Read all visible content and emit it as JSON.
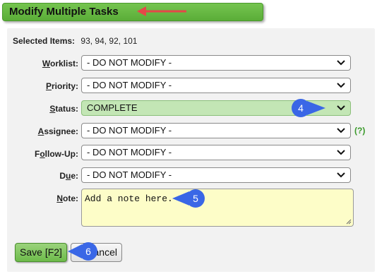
{
  "header": {
    "title": "Modify Multiple Tasks"
  },
  "selected": {
    "label": "Selected Items:",
    "value": "93, 94, 92, 101"
  },
  "fields": {
    "worklist": {
      "pre": "",
      "key": "W",
      "post": "orklist:",
      "value": "- DO NOT MODIFY -"
    },
    "priority": {
      "pre": "",
      "key": "P",
      "post": "riority:",
      "value": "- DO NOT MODIFY -"
    },
    "status": {
      "pre": "",
      "key": "S",
      "post": "tatus:",
      "value": "COMPLETE"
    },
    "assignee": {
      "pre": "",
      "key": "A",
      "post": "ssignee:",
      "value": "- DO NOT MODIFY -"
    },
    "followup": {
      "pre": "F",
      "key": "o",
      "post": "llow-Up:",
      "value": "- DO NOT MODIFY -"
    },
    "due": {
      "pre": "D",
      "key": "u",
      "post": "e:",
      "value": "- DO NOT MODIFY -"
    },
    "note": {
      "pre": "",
      "key": "N",
      "post": "ote:",
      "value": "Add a note here."
    }
  },
  "help_link": "(?)",
  "buttons": {
    "save": "Save [F2]",
    "cancel": "Cancel"
  },
  "callouts": {
    "status": "4",
    "note": "5",
    "save": "6"
  },
  "colors": {
    "header": "#6bbd45",
    "callout": "#3a67e6",
    "arrow": "#e44848",
    "status_bg": "#c3e6b5",
    "note_bg": "#fdfdc8"
  }
}
